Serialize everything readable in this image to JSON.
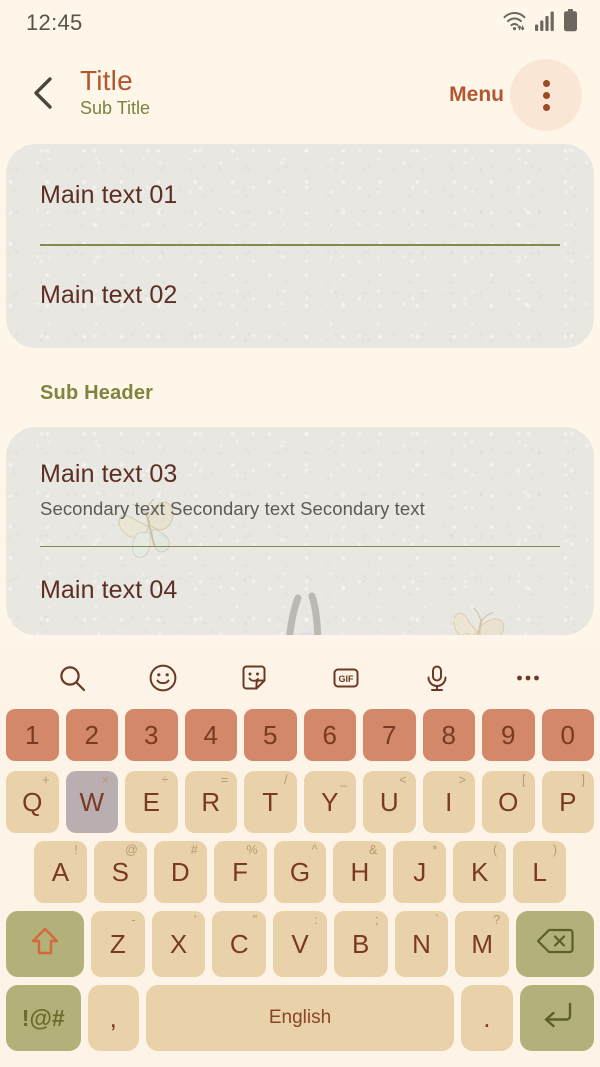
{
  "statusbar": {
    "time": "12:45",
    "icons": [
      "wifi-icon",
      "cellular-signal-icon",
      "battery-icon"
    ]
  },
  "appbar": {
    "back_icon": "chevron-left-icon",
    "title": "Title",
    "subtitle": "Sub Title",
    "menu_label": "Menu",
    "overflow_icon": "more-vertical-icon"
  },
  "colors": {
    "page_background": "#fdf6e9",
    "card_background": "#e9e7e1",
    "title": "#b35730",
    "subtitle": "#7d8240",
    "subheader": "#81843f",
    "main_text": "#5c2f23",
    "secondary_text": "#5c5a55",
    "divider": "#7e8540",
    "accent": "#b35730",
    "key_number": "#d4886a",
    "key_letter": "#e9d2aa",
    "key_function": "#b2b179",
    "key_pressed": "#b9aeb0",
    "keyboard_background": "#fdf4e7"
  },
  "content": {
    "card1": {
      "rows": [
        {
          "main": "Main text 01"
        },
        {
          "main": "Main text 02"
        }
      ]
    },
    "subheader": "Sub Header",
    "card2": {
      "rows": [
        {
          "main": "Main text 03",
          "secondary": "Secondary text Secondary text Secondary text"
        },
        {
          "main": "Main text 04"
        }
      ]
    }
  },
  "keyboard": {
    "toolbar": [
      {
        "name": "search-icon",
        "label": ""
      },
      {
        "name": "emoji-icon",
        "label": ""
      },
      {
        "name": "sticker-icon",
        "label": ""
      },
      {
        "name": "gif-icon",
        "label": "GIF"
      },
      {
        "name": "microphone-icon",
        "label": ""
      },
      {
        "name": "more-horizontal-icon",
        "label": ""
      }
    ],
    "number_row": [
      "1",
      "2",
      "3",
      "4",
      "5",
      "6",
      "7",
      "8",
      "9",
      "0"
    ],
    "row1": [
      {
        "key": "Q",
        "sup": "+"
      },
      {
        "key": "W",
        "sup": "×",
        "pressed": true
      },
      {
        "key": "E",
        "sup": "÷"
      },
      {
        "key": "R",
        "sup": "="
      },
      {
        "key": "T",
        "sup": "/"
      },
      {
        "key": "Y",
        "sup": "_"
      },
      {
        "key": "U",
        "sup": "<"
      },
      {
        "key": "I",
        "sup": ">"
      },
      {
        "key": "O",
        "sup": "["
      },
      {
        "key": "P",
        "sup": "]"
      }
    ],
    "row2": [
      {
        "key": "A",
        "sup": "!"
      },
      {
        "key": "S",
        "sup": "@"
      },
      {
        "key": "D",
        "sup": "#"
      },
      {
        "key": "F",
        "sup": "%"
      },
      {
        "key": "G",
        "sup": "^"
      },
      {
        "key": "H",
        "sup": "&"
      },
      {
        "key": "J",
        "sup": "*"
      },
      {
        "key": "K",
        "sup": "("
      },
      {
        "key": "L",
        "sup": ")"
      }
    ],
    "row3": {
      "shift": {
        "name": "shift-key",
        "icon": "shift-arrow-icon"
      },
      "letters": [
        {
          "key": "Z",
          "sup": "-"
        },
        {
          "key": "X",
          "sup": "'"
        },
        {
          "key": "C",
          "sup": "\""
        },
        {
          "key": "V",
          "sup": ":"
        },
        {
          "key": "B",
          "sup": ";"
        },
        {
          "key": "N",
          "sup": "`"
        },
        {
          "key": "M",
          "sup": "?"
        }
      ],
      "backspace": {
        "name": "backspace-key",
        "icon": "backspace-icon"
      }
    },
    "row4": {
      "symbols_label": "!@#",
      "comma": ",",
      "space_label": "English",
      "period": ".",
      "enter_icon": "enter-key-icon"
    }
  }
}
